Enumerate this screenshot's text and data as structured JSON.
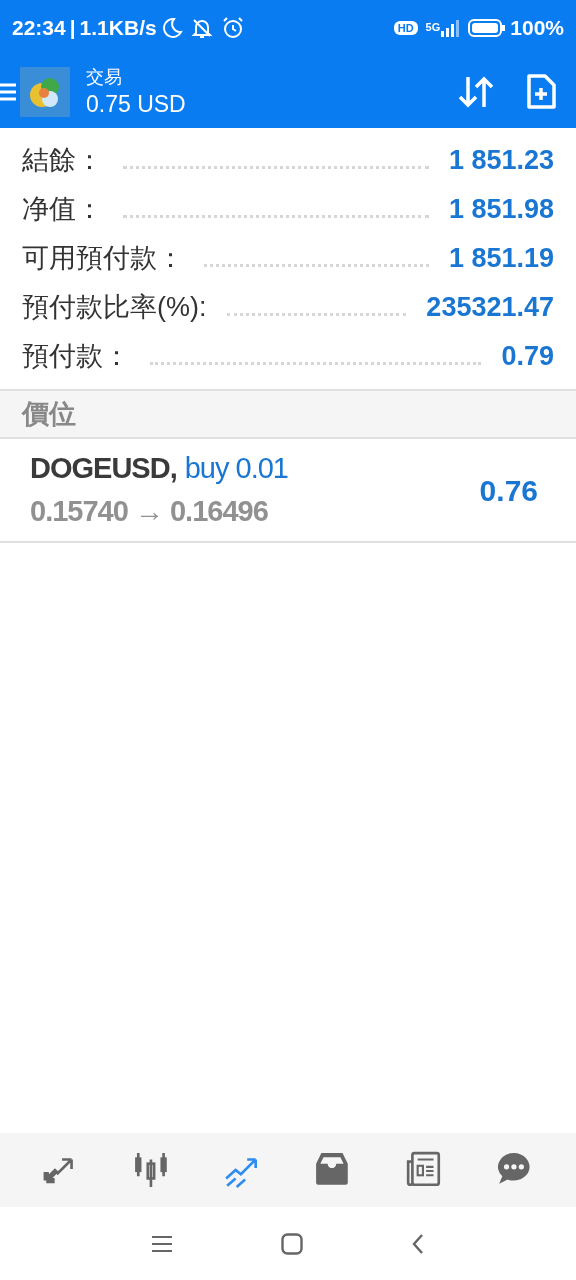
{
  "status_bar": {
    "time": "22:34",
    "separator": "|",
    "speed": "1.1KB/s",
    "hd": "HD",
    "network": "5G",
    "battery": "100%"
  },
  "header": {
    "title": "交易",
    "subtitle": "0.75 USD"
  },
  "summary": [
    {
      "label": "結餘：",
      "value": "1 851.23"
    },
    {
      "label": "净值：",
      "value": "1 851.98"
    },
    {
      "label": "可用預付款：",
      "value": "1 851.19"
    },
    {
      "label": "預付款比率(%):",
      "value": "235321.47"
    },
    {
      "label": "預付款：",
      "value": "0.79"
    }
  ],
  "section": {
    "title": "價位"
  },
  "positions": [
    {
      "symbol": "DOGEUSD,",
      "side": "buy 0.01",
      "prices": "0.15740 → 0.16496",
      "profit": "0.76"
    }
  ],
  "bottom_nav": [
    {
      "kind": "quotes",
      "selected": false
    },
    {
      "kind": "chart",
      "selected": false
    },
    {
      "kind": "trade",
      "selected": true
    },
    {
      "kind": "history",
      "selected": false
    },
    {
      "kind": "news",
      "selected": false
    },
    {
      "kind": "chat",
      "selected": false
    }
  ]
}
